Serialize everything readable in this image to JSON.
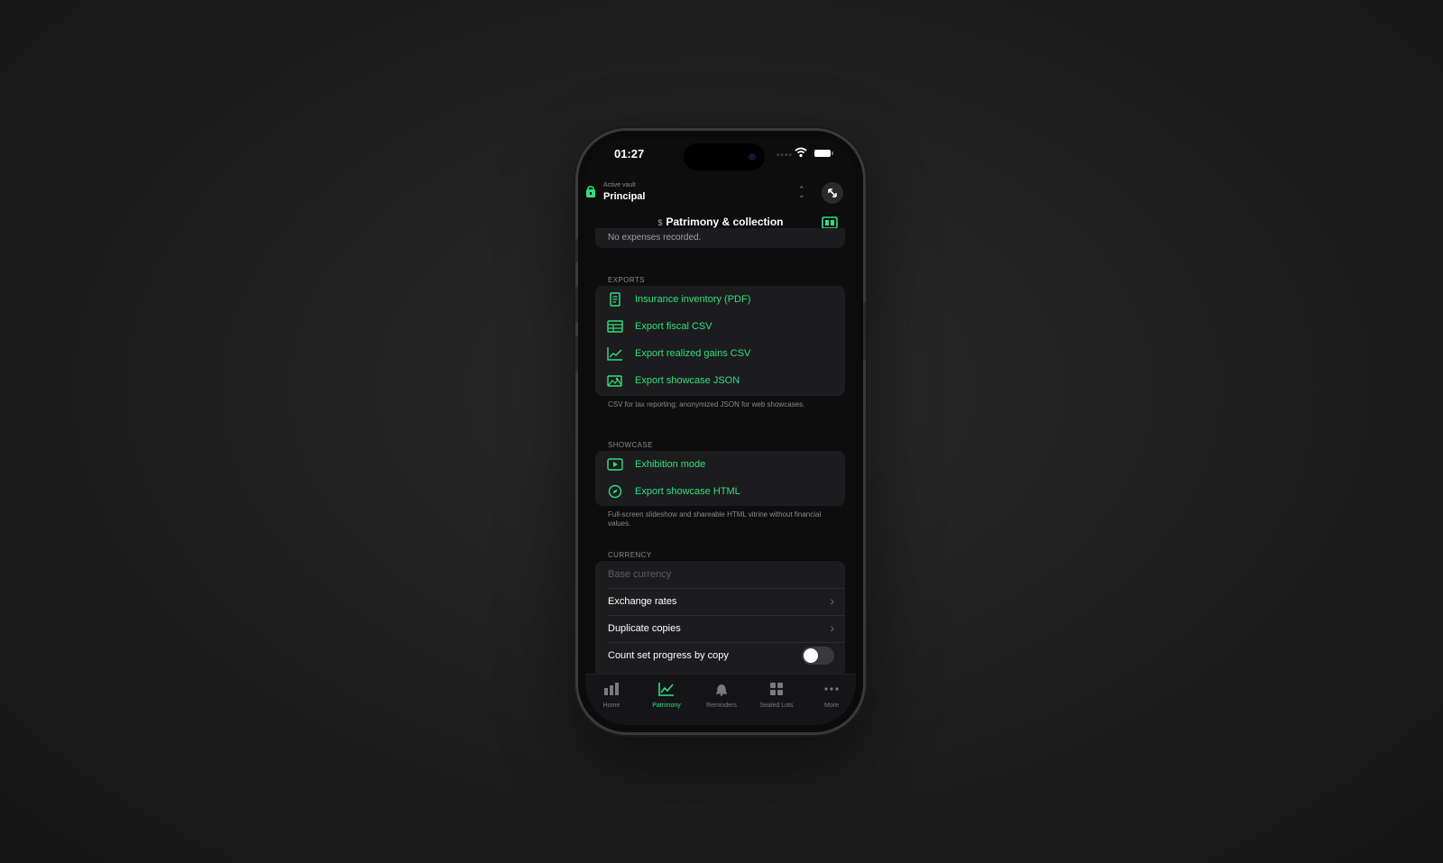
{
  "status_bar": {
    "time": "01:27",
    "signal": "••••"
  },
  "vault": {
    "subtitle": "Active vault",
    "name": "Principal"
  },
  "nav": {
    "title": "Patrimony & collection"
  },
  "expenses": {
    "empty_text": "No expenses recorded."
  },
  "exports": {
    "header": "EXPORTS",
    "items": [
      {
        "label": "Insurance inventory (PDF)",
        "icon": "document-icon"
      },
      {
        "label": "Export fiscal CSV",
        "icon": "table-icon"
      },
      {
        "label": "Export realized gains CSV",
        "icon": "chart-line-icon"
      },
      {
        "label": "Export showcase JSON",
        "icon": "photo-icon"
      }
    ],
    "footnote": "CSV for tax reporting; anonymized JSON for web showcases."
  },
  "showcase": {
    "header": "SHOWCASE",
    "items": [
      {
        "label": "Exhibition mode",
        "icon": "play-rectangle-icon"
      },
      {
        "label": "Export showcase HTML",
        "icon": "compass-icon"
      }
    ],
    "footnote": "Full-screen slideshow and shareable HTML vitrine without financial values."
  },
  "currency": {
    "header": "CURRENCY",
    "base_currency_placeholder": "Base currency",
    "exchange_rates": "Exchange rates",
    "duplicate_copies": "Duplicate copies",
    "count_set_progress": "Count set progress by copy",
    "count_set_progress_enabled": false
  },
  "tabbar": {
    "items": [
      {
        "label": "Home",
        "icon": "bar-chart-icon",
        "active": false
      },
      {
        "label": "Patrimony",
        "icon": "trend-icon",
        "active": true
      },
      {
        "label": "Reminders",
        "icon": "bell-icon",
        "active": false
      },
      {
        "label": "Sealed Lots",
        "icon": "grid-icon",
        "active": false
      },
      {
        "label": "More",
        "icon": "ellipsis-icon",
        "active": false
      }
    ]
  },
  "colors": {
    "accent": "#2fe07e",
    "background": "#0d0d0e",
    "card": "#1c1c1e"
  }
}
